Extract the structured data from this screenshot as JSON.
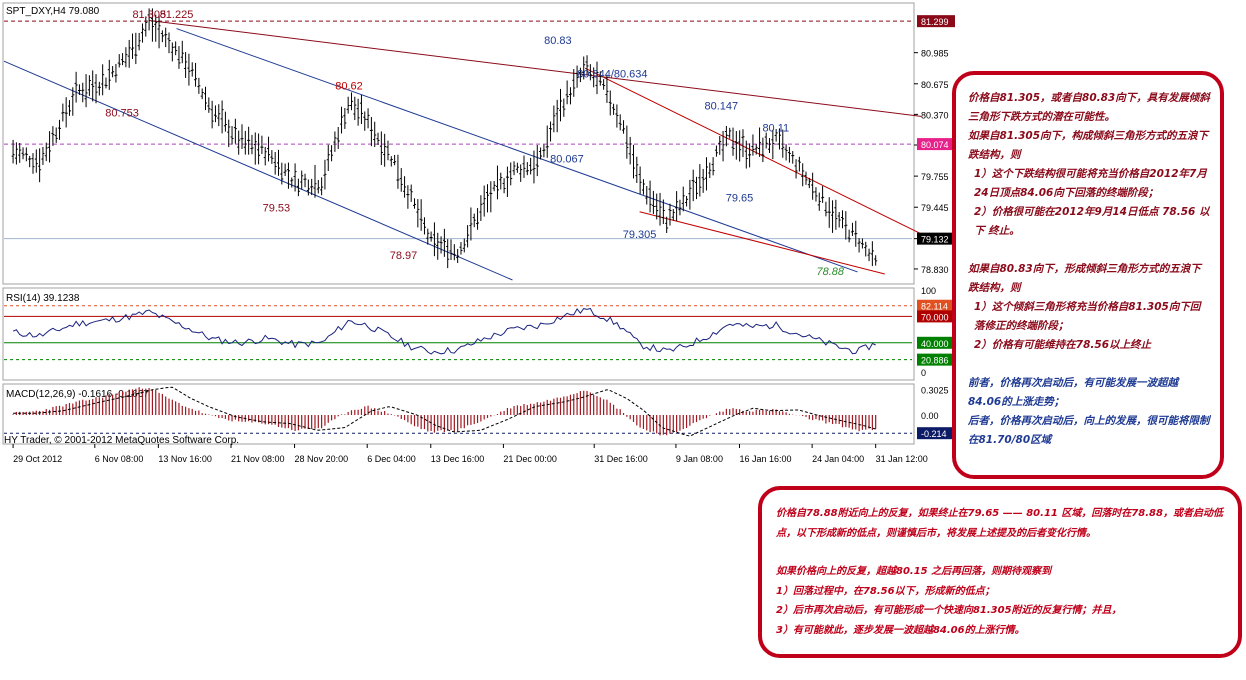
{
  "header": {
    "symbol": "SPT_DXY,H4",
    "last": "79.080"
  },
  "price_panel": {
    "price_axis_ticks": [
      "80.985",
      "80.675",
      "80.370",
      "80.065",
      "79.755",
      "79.445",
      "79.132",
      "78.830"
    ],
    "price_tags": [
      {
        "value": "81.299",
        "color": "#8b0a1a"
      },
      {
        "value": "80.074",
        "color": "#e8208a"
      },
      {
        "value": "79.132",
        "color": "#000000"
      }
    ],
    "annotations": [
      {
        "text": "81.305",
        "color": "#8b0a1a",
        "x": "13 Nov 16:00",
        "y": 81.33
      },
      {
        "text": "81.225",
        "color": "#8b0a1a",
        "x": "16 Nov",
        "y": 81.33
      },
      {
        "text": "80.62",
        "color": "#c00000",
        "x": "5 Dec",
        "y": 80.62
      },
      {
        "text": "80.753",
        "color": "#8b0a1a",
        "x": "10 Nov",
        "y": 80.35
      },
      {
        "text": "79.53",
        "color": "#8b0a1a",
        "x": "27 Nov",
        "y": 79.4
      },
      {
        "text": "78.97",
        "color": "#8b0a1a",
        "x": "11 Dec",
        "y": 78.93
      },
      {
        "text": "80.83",
        "color": "#1f3a93",
        "x": "28 Dec",
        "y": 81.07
      },
      {
        "text": "80.644/80.634",
        "color": "#1f3a93",
        "x": "3 Jan",
        "y": 80.74
      },
      {
        "text": "80.067",
        "color": "#1f3a93",
        "x": "29 Dec",
        "y": 79.89
      },
      {
        "text": "79.305",
        "color": "#1f3a93",
        "x": "6 Jan",
        "y": 79.14
      },
      {
        "text": "80.147",
        "color": "#1f3a93",
        "x": "15 Jan",
        "y": 80.42
      },
      {
        "text": "80.11",
        "color": "#1f3a93",
        "x": "21 Jan",
        "y": 80.2
      },
      {
        "text": "79.65",
        "color": "#1f3a93",
        "x": "17 Jan",
        "y": 79.5
      },
      {
        "text": "78.88",
        "color": "#2e8b2e",
        "x": "27 Jan",
        "y": 78.77
      }
    ]
  },
  "rsi_panel": {
    "label": "RSI(14) 39.1238",
    "axis_ticks": [
      "100",
      "0"
    ],
    "tags": [
      {
        "value": "82.114",
        "color": "#e05020"
      },
      {
        "value": "70.000",
        "color": "#b00000"
      },
      {
        "value": "40.000",
        "color": "#008000"
      },
      {
        "value": "20.886",
        "color": "#008000"
      }
    ]
  },
  "macd_panel": {
    "label": "MACD(12,26,9) -0.1616 -0.1667",
    "axis_ticks": [
      "0.3025",
      "0.00"
    ],
    "tags": [
      {
        "value": "-0.214",
        "color": "#0c1b66"
      }
    ]
  },
  "copyright": "HY Trader, © 2001-2012 MetaQuotes Software Corp.",
  "time_axis": [
    "29 Oct 2012",
    "6 Nov 08:00",
    "13 Nov 16:00",
    "21 Nov 08:00",
    "28 Nov 20:00",
    "6 Dec 04:00",
    "13 Dec 16:00",
    "21 Dec 00:00",
    "31 Dec 16:00",
    "9 Jan 08:00",
    "16 Jan 16:00",
    "24 Jan 04:00",
    "31 Jan 12:00"
  ],
  "chart_data": {
    "type": "line",
    "symbol": "SPT_DXY",
    "timeframe": "H4",
    "x": [
      "29 Oct",
      "1 Nov",
      "5 Nov",
      "8 Nov",
      "11 Nov",
      "13 Nov",
      "15 Nov",
      "17 Nov",
      "20 Nov",
      "23 Nov",
      "26 Nov",
      "29 Nov",
      "2 Dec",
      "5 Dec",
      "7 Dec",
      "10 Dec",
      "12 Dec",
      "14 Dec",
      "17 Dec",
      "20 Dec",
      "23 Dec",
      "26 Dec",
      "28 Dec",
      "31 Dec",
      "2 Jan",
      "4 Jan",
      "6 Jan",
      "9 Jan",
      "11 Jan",
      "14 Jan",
      "16 Jan",
      "18 Jan",
      "21 Jan",
      "23 Jan",
      "25 Jan",
      "28 Jan",
      "30 Jan",
      "1 Feb"
    ],
    "close": [
      80.0,
      79.9,
      80.6,
      80.7,
      81.0,
      81.3,
      81.1,
      80.9,
      80.4,
      80.1,
      80.0,
      79.7,
      79.7,
      80.5,
      80.3,
      79.9,
      79.5,
      79.1,
      79.0,
      79.5,
      79.8,
      79.9,
      80.4,
      80.83,
      80.64,
      80.3,
      79.7,
      79.31,
      79.5,
      79.9,
      80.15,
      80.0,
      80.11,
      79.9,
      79.65,
      79.3,
      79.132,
      78.88
    ],
    "rsi": [
      52,
      48,
      62,
      65,
      70,
      75,
      66,
      58,
      44,
      40,
      45,
      38,
      40,
      65,
      60,
      45,
      35,
      30,
      32,
      45,
      55,
      60,
      68,
      78,
      70,
      58,
      38,
      30,
      36,
      50,
      62,
      58,
      60,
      52,
      45,
      35,
      30,
      39
    ],
    "macd_hist": [
      0.02,
      0.05,
      0.15,
      0.22,
      0.3,
      0.33,
      0.2,
      0.1,
      -0.02,
      -0.08,
      -0.1,
      -0.18,
      -0.15,
      0.05,
      0.1,
      0.0,
      -0.12,
      -0.2,
      -0.18,
      -0.05,
      0.1,
      0.15,
      0.2,
      0.3,
      0.2,
      0.05,
      -0.15,
      -0.25,
      -0.15,
      0.0,
      0.08,
      0.05,
      0.06,
      0.0,
      -0.05,
      -0.12,
      -0.18,
      -0.17
    ],
    "ylim": [
      78.7,
      81.45
    ],
    "trendlines": [
      {
        "color": "#1f3a93",
        "from": {
          "x": "28 Oct",
          "y": 80.9
        },
        "to": {
          "x": "23 Dec",
          "y": 78.72
        }
      },
      {
        "color": "#1f3a93",
        "from": {
          "x": "16 Nov",
          "y": 81.225
        },
        "to": {
          "x": "30 Jan",
          "y": 78.8
        }
      },
      {
        "color": "#8b0a1a",
        "from": {
          "x": "13 Nov",
          "y": 81.305
        },
        "to": {
          "x": "6 Feb",
          "y": 80.35
        }
      },
      {
        "color": "#c00000",
        "from": {
          "x": "31 Dec",
          "y": 80.83
        },
        "to": {
          "x": "6 Feb",
          "y": 79.18
        }
      },
      {
        "color": "#c00000",
        "from": {
          "x": "6 Jan",
          "y": 79.4
        },
        "to": {
          "x": "2 Feb",
          "y": 78.78
        }
      }
    ],
    "horizontal_levels": [
      {
        "y": 81.299,
        "color": "#8b0a1a",
        "style": "dashed"
      },
      {
        "y": 80.074,
        "color": "#b040c0",
        "style": "dashed"
      },
      {
        "y": 79.132,
        "color": "#a0b4d0",
        "style": "solid"
      }
    ],
    "grid": false
  },
  "note1": {
    "lines": [
      "价格自81.305，或者自80.83向下，具有发展倾斜三角形下跌方式的潜在可能性。",
      "如果自81.305向下，构成倾斜三角形方式的五浪下跌结构，则",
      "1）这个下跌结构很可能将充当价格自2012年7月24日顶点84.06向下回落的终端阶段；",
      "2）价格很可能在2012年9月14日低点 78.56 以下 终止。",
      "",
      "如果自80.83向下，形成倾斜三角形方式的五浪下跌结构，则",
      "1）这个倾斜三角形将充当价格自81.305向下回落修正的终端阶段；",
      "2）价格有可能维持在78.56以上终止"
    ],
    "blue_lines": [
      "前者，价格再次启动后，有可能发展一波超越84.06的上涨走势；",
      "后者，价格再次启动后，向上的发展，很可能将限制在81.70/80区域"
    ]
  },
  "note2": {
    "lines": [
      "价格自78.88附近向上的反复，如果终止在79.65 —— 80.11 区域，回落时在78.88，或者启动低点，以下形成新的低点，则谨慎后市，将发展上述提及的后者变化行情。",
      "",
      "如果价格向上的反复，超越80.15 之后再回落，则期待观察到",
      "1）回落过程中，在78.56以下，形成新的低点；",
      "2）后市再次启动后，有可能形成一个快速向81.305附近的反复行情；并且，",
      "3）有可能就此，逐步发展一波超越84.06的上涨行情。"
    ]
  }
}
